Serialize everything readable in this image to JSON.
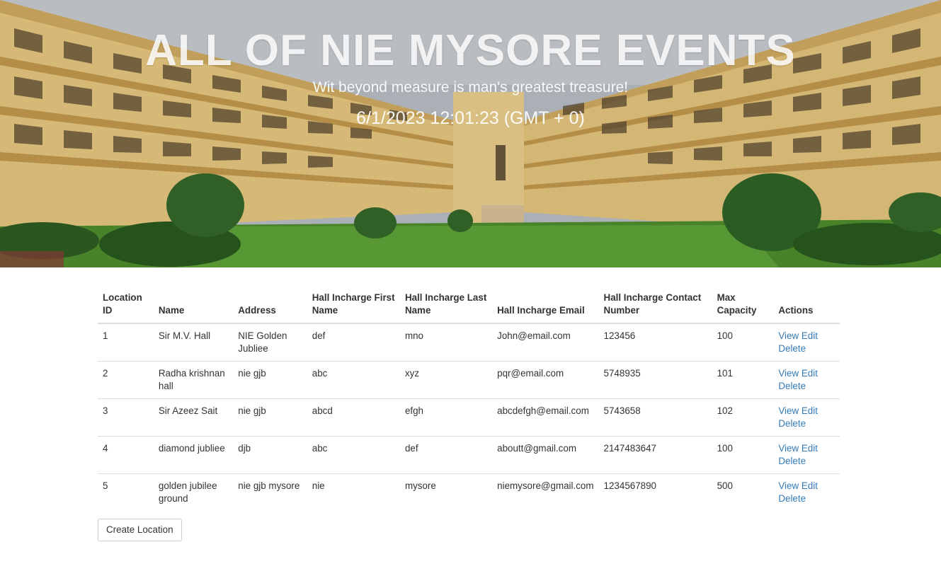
{
  "hero": {
    "title": "ALL OF NIE MYSORE EVENTS",
    "subtitle": "Wit beyond measure is man's greatest treasure!",
    "datetime": "6/1/2023 12:01:23 (GMT + 0)"
  },
  "table": {
    "headers": [
      "Location ID",
      "Name",
      "Address",
      "Hall Incharge First Name",
      "Hall Incharge Last Name",
      "Hall Incharge Email",
      "Hall Incharge Contact Number",
      "Max Capacity",
      "Actions"
    ],
    "rows": [
      {
        "id": "1",
        "name": "Sir M.V. Hall",
        "address": "NIE Golden Jubliee",
        "first": "def",
        "last": "mno",
        "email": "John@email.com",
        "contact": "123456",
        "capacity": "100"
      },
      {
        "id": "2",
        "name": "Radha krishnan hall",
        "address": "nie gjb",
        "first": "abc",
        "last": "xyz",
        "email": "pqr@email.com",
        "contact": "5748935",
        "capacity": "101"
      },
      {
        "id": "3",
        "name": "Sir Azeez Sait",
        "address": "nie gjb",
        "first": "abcd",
        "last": "efgh",
        "email": "abcdefgh@email.com",
        "contact": "5743658",
        "capacity": "102"
      },
      {
        "id": "4",
        "name": "diamond jubliee",
        "address": "djb",
        "first": "abc",
        "last": "def",
        "email": "aboutt@gmail.com",
        "contact": "2147483647",
        "capacity": "100"
      },
      {
        "id": "5",
        "name": "golden jubilee ground",
        "address": "nie gjb mysore",
        "first": "nie",
        "last": "mysore",
        "email": "niemysore@gmail.com",
        "contact": "1234567890",
        "capacity": "500"
      }
    ],
    "actions": {
      "view": "View",
      "edit": "Edit",
      "delete": "Delete"
    }
  },
  "create_button": "Create Location",
  "colors": {
    "link": "#337ab7",
    "border": "#dddddd",
    "text": "#333333"
  }
}
